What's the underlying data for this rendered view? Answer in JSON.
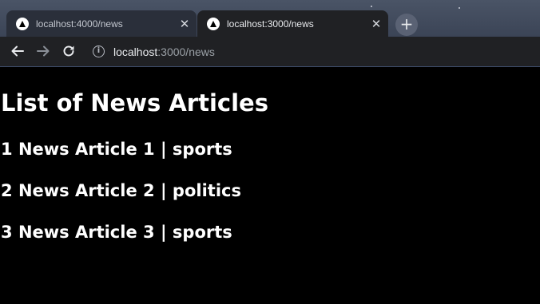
{
  "browser": {
    "tabs": [
      {
        "title": "localhost:4000/news",
        "active": false
      },
      {
        "title": "localhost:3000/news",
        "active": true
      }
    ],
    "close_glyph": "✕",
    "new_tab_glyph": "+",
    "address": {
      "host": "localhost",
      "rest": ":3000/news"
    },
    "info_glyph": "i"
  },
  "page": {
    "heading": "List of News Articles",
    "articles": [
      {
        "id": "1",
        "title": "News Article 1",
        "category": "sports"
      },
      {
        "id": "2",
        "title": "News Article 2",
        "category": "politics"
      },
      {
        "id": "3",
        "title": "News Article 3",
        "category": "sports"
      }
    ],
    "separator": "|"
  },
  "colors": {
    "tabbar": "#3b4456",
    "active_tab": "#202124",
    "page_background": "#000000",
    "page_text": "#ffffff"
  }
}
